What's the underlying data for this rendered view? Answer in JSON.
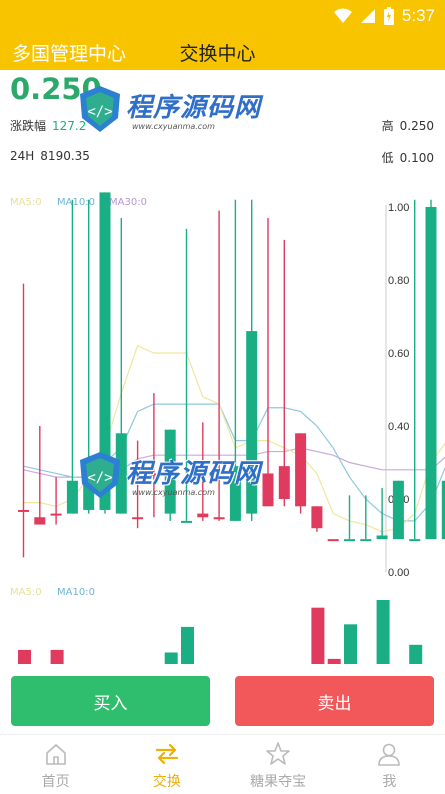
{
  "status": {
    "time": "5:37",
    "wifi_icon": "wifi-icon",
    "signal_icon": "signal-icon",
    "battery_icon": "battery-icon"
  },
  "header": {
    "back_title": "多国管理中心",
    "title": "交换中心"
  },
  "ticker": {
    "price": "0.250",
    "change_label": "涨跌幅",
    "change_value": "127.2",
    "volume_label": "24H",
    "volume_value": "8190.35",
    "high_label": "高",
    "high_value": "0.250",
    "low_label": "低",
    "low_value": "0.100"
  },
  "legend": {
    "ma5": "MA5:0",
    "ma10": "MA10:0",
    "ma30": "MA30:0",
    "vol_ma5": "MA5:0",
    "vol_ma10": "MA10:0"
  },
  "watermark": {
    "name": "程序源码网",
    "url": "www.cxyuanma.com"
  },
  "colors": {
    "up": "#1AAE85",
    "down": "#E03A5E",
    "ma5": "#F0E6A0",
    "ma10": "#8EC8E0",
    "ma30": "#C9A9DE",
    "accent": "#F8C400"
  },
  "chart_data": {
    "type": "candlestick",
    "y_ticks": [
      "1.00",
      "0.80",
      "0.60",
      "0.40",
      "0.20",
      "0.00"
    ],
    "ylim": [
      0,
      1
    ],
    "candles": [
      {
        "o": 0.17,
        "c": 0.17,
        "h": 0.79,
        "l": 0.04,
        "up": false
      },
      {
        "o": 0.15,
        "c": 0.13,
        "h": 0.4,
        "l": 0.13,
        "up": false
      },
      {
        "o": 0.16,
        "c": 0.16,
        "h": 0.26,
        "l": 0.13,
        "up": false
      },
      {
        "o": 0.16,
        "c": 0.25,
        "h": 1.02,
        "l": 0.16,
        "up": true
      },
      {
        "o": 0.17,
        "c": 0.25,
        "h": 1.02,
        "l": 0.16,
        "up": true
      },
      {
        "o": 0.17,
        "c": 1.04,
        "h": 1.04,
        "l": 0.16,
        "up": true
      },
      {
        "o": 0.16,
        "c": 0.38,
        "h": 0.97,
        "l": 0.16,
        "up": true
      },
      {
        "o": 0.15,
        "c": 0.15,
        "h": 0.36,
        "l": 0.12,
        "up": false
      },
      {
        "o": 0.27,
        "c": 0.27,
        "h": 0.49,
        "l": 0.15,
        "up": false
      },
      {
        "o": 0.16,
        "c": 0.39,
        "h": 0.39,
        "l": 0.14,
        "up": true
      },
      {
        "o": 0.14,
        "c": 0.14,
        "h": 0.94,
        "l": 0.14,
        "up": true
      },
      {
        "o": 0.16,
        "c": 0.15,
        "h": 0.41,
        "l": 0.14,
        "up": false
      },
      {
        "o": 0.15,
        "c": 0.15,
        "h": 0.99,
        "l": 0.14,
        "up": false
      },
      {
        "o": 0.14,
        "c": 0.29,
        "h": 1.02,
        "l": 0.14,
        "up": true
      },
      {
        "o": 0.16,
        "c": 0.66,
        "h": 1.02,
        "l": 0.14,
        "up": true
      },
      {
        "o": 0.27,
        "c": 0.18,
        "h": 0.97,
        "l": 0.18,
        "up": false
      },
      {
        "o": 0.29,
        "c": 0.2,
        "h": 0.91,
        "l": 0.18,
        "up": false
      },
      {
        "o": 0.38,
        "c": 0.18,
        "h": 0.38,
        "l": 0.16,
        "up": false
      },
      {
        "o": 0.12,
        "c": 0.18,
        "h": 0.18,
        "l": 0.11,
        "up": false
      },
      {
        "o": 0.09,
        "c": 0.09,
        "h": 0.09,
        "l": 0.09,
        "up": false
      },
      {
        "o": 0.09,
        "c": 0.09,
        "h": 0.21,
        "l": 0.09,
        "up": true
      },
      {
        "o": 0.09,
        "c": 0.09,
        "h": 0.21,
        "l": 0.09,
        "up": true
      },
      {
        "o": 0.09,
        "c": 0.1,
        "h": 0.23,
        "l": 0.09,
        "up": true
      },
      {
        "o": 0.09,
        "c": 0.25,
        "h": 0.25,
        "l": 0.09,
        "up": true
      },
      {
        "o": 0.09,
        "c": 0.09,
        "h": 1.02,
        "l": 0.09,
        "up": true
      },
      {
        "o": 0.09,
        "c": 1.0,
        "h": 1.02,
        "l": 0.09,
        "up": true
      },
      {
        "o": 0.09,
        "c": 0.25,
        "h": 0.25,
        "l": 0.09,
        "up": true
      }
    ],
    "ma5": [
      0.19,
      0.19,
      0.18,
      0.2,
      0.26,
      0.34,
      0.49,
      0.62,
      0.6,
      0.6,
      0.6,
      0.48,
      0.46,
      0.34,
      0.36,
      0.36,
      0.34,
      0.32,
      0.27,
      0.16,
      0.14,
      0.13,
      0.11,
      0.12,
      0.16,
      0.3,
      0.36
    ],
    "ma10": [
      0.29,
      0.28,
      0.27,
      0.26,
      0.26,
      0.3,
      0.34,
      0.44,
      0.46,
      0.46,
      0.46,
      0.46,
      0.46,
      0.36,
      0.36,
      0.45,
      0.45,
      0.44,
      0.4,
      0.34,
      0.26,
      0.2,
      0.16,
      0.14,
      0.14,
      0.19,
      0.3
    ],
    "ma30": [
      0.28,
      0.27,
      0.26,
      0.26,
      0.26,
      0.27,
      0.28,
      0.31,
      0.32,
      0.32,
      0.32,
      0.32,
      0.32,
      0.32,
      0.32,
      0.33,
      0.33,
      0.34,
      0.33,
      0.32,
      0.3,
      0.29,
      0.28,
      0.28,
      0.28,
      0.28,
      0.32
    ],
    "volumes": [
      0.22,
      0,
      0.22,
      0,
      0,
      0,
      0,
      0,
      0,
      0.18,
      0.58,
      0,
      0,
      0,
      0,
      0,
      0,
      0,
      0.88,
      0.08,
      0.62,
      0.0,
      1.0,
      0,
      0.3,
      0,
      0
    ]
  },
  "actions": {
    "buy": "买入",
    "sell": "卖出"
  },
  "tabs": [
    {
      "label": "首页",
      "icon": "home-icon",
      "active": false
    },
    {
      "label": "交换",
      "icon": "exchange-icon",
      "active": true
    },
    {
      "label": "糖果夺宝",
      "icon": "star-icon",
      "active": false
    },
    {
      "label": "我",
      "icon": "person-icon",
      "active": false
    }
  ]
}
